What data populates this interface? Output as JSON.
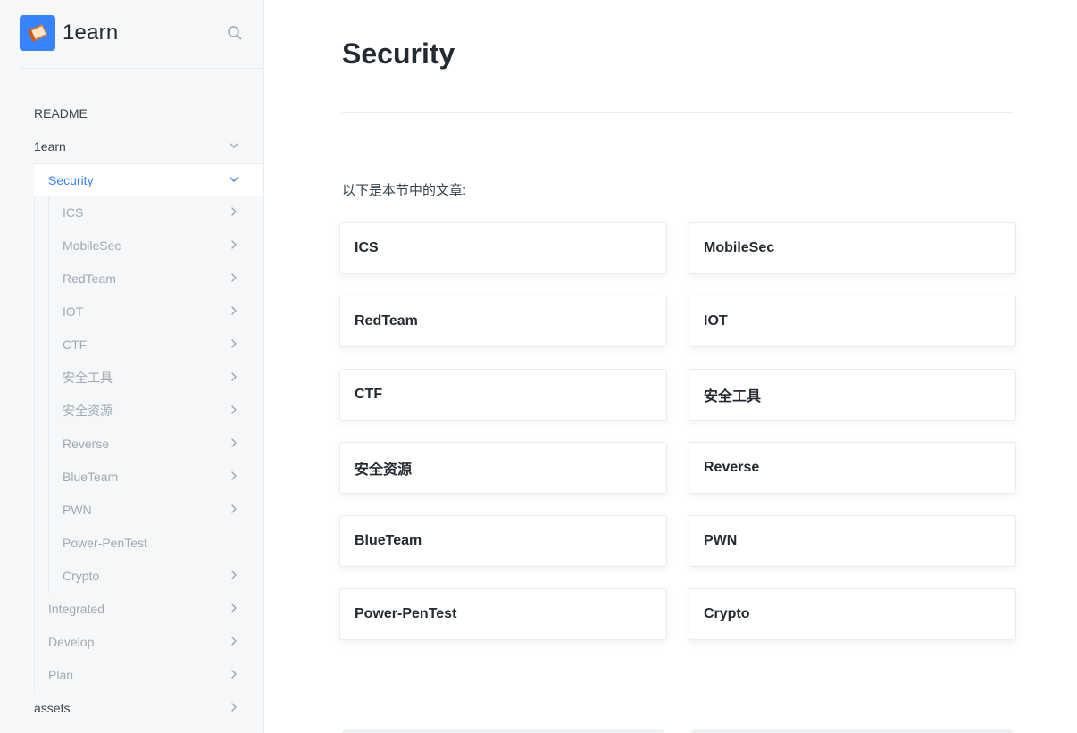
{
  "brand": {
    "name": "1earn",
    "logo_icon": "book-icon",
    "accent": "#3884ff"
  },
  "sidebar": {
    "search_icon": "search-icon",
    "items": [
      {
        "label": "README"
      },
      {
        "label": "1earn",
        "expanded": true
      },
      {
        "label": "Security",
        "expanded": true,
        "active": true
      },
      {
        "label": "ICS"
      },
      {
        "label": "MobileSec"
      },
      {
        "label": "RedTeam"
      },
      {
        "label": "IOT"
      },
      {
        "label": "CTF"
      },
      {
        "label": "安全工具"
      },
      {
        "label": "安全资源"
      },
      {
        "label": "Reverse"
      },
      {
        "label": "BlueTeam"
      },
      {
        "label": "PWN"
      },
      {
        "label": "Power-PenTest"
      },
      {
        "label": "Crypto"
      },
      {
        "label": "Integrated"
      },
      {
        "label": "Develop"
      },
      {
        "label": "Plan"
      },
      {
        "label": "assets"
      }
    ]
  },
  "main": {
    "title": "Security",
    "intro": "以下是本节中的文章:",
    "cards": [
      "ICS",
      "MobileSec",
      "RedTeam",
      "IOT",
      "CTF",
      "安全工具",
      "安全资源",
      "Reverse",
      "BlueTeam",
      "PWN",
      "Power-PenTest",
      "Crypto"
    ]
  },
  "colors": {
    "sidebar_bg": "#f5f7f9",
    "active_text": "#3884ff",
    "muted_text": "#9daab6",
    "border": "#e6ecf1"
  }
}
